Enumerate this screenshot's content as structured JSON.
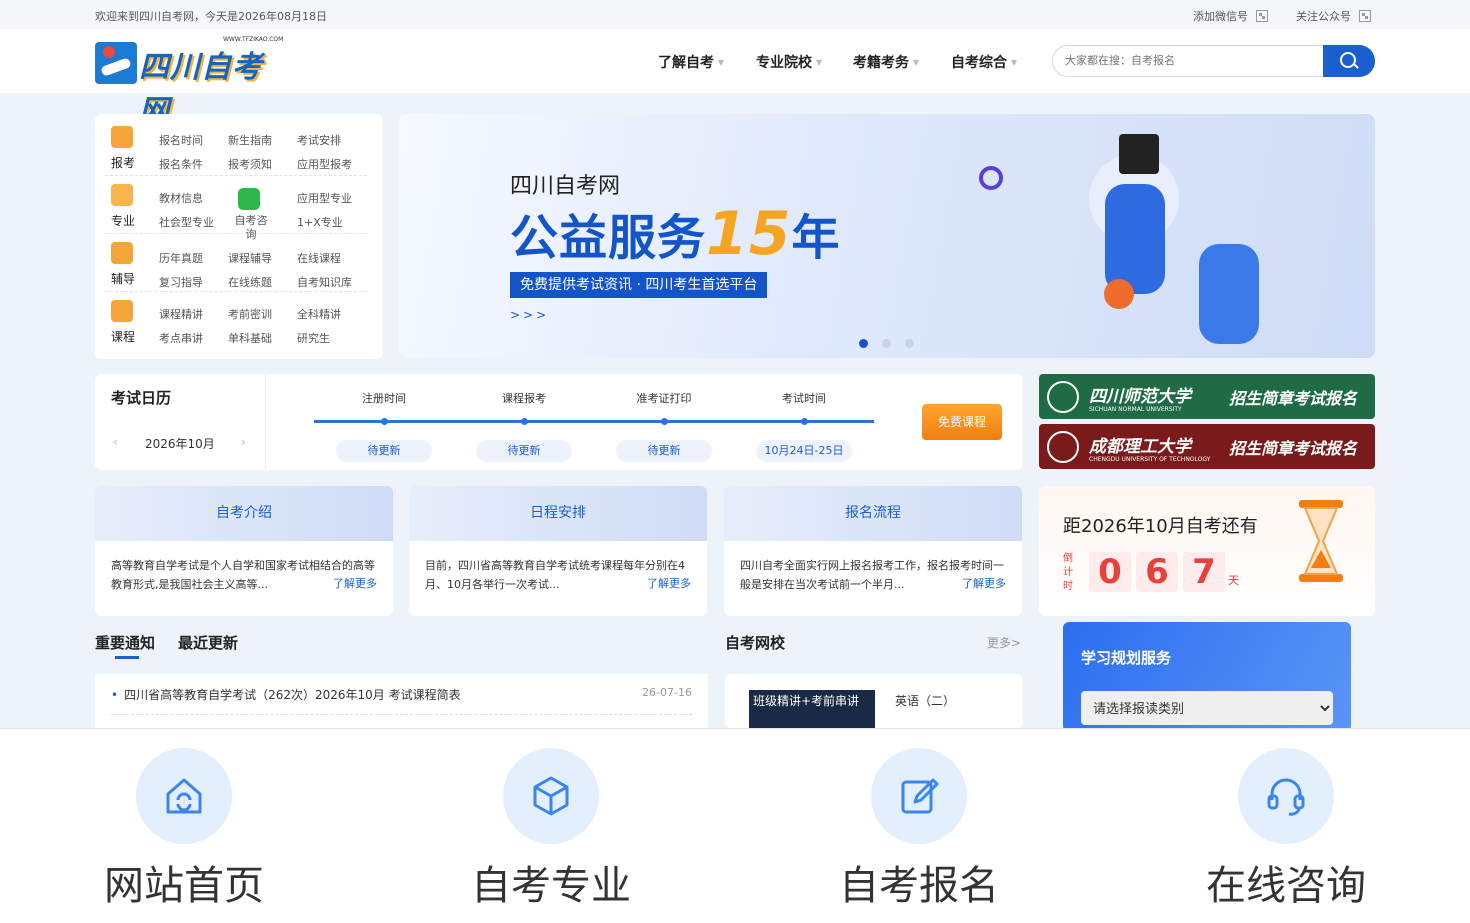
{
  "topbar": {
    "welcome": "欢迎来到四川自考网，今天是2026年08月18日",
    "wechat": "添加微信号",
    "official": "关注公众号"
  },
  "logo": {
    "text": "四川自考网",
    "url_text": "WWW.TFZIKAO.COM"
  },
  "nav": [
    "了解自考",
    "专业院校",
    "考籍考务",
    "自考综合"
  ],
  "search": {
    "placeholder": "大家都在搜：自考报名"
  },
  "menu": {
    "rows": [
      {
        "label": "报考",
        "items": [
          "报名时间",
          "新生指南",
          "考试安排",
          "报名条件",
          "报考须知",
          "应用型报考"
        ]
      },
      {
        "label": "专业",
        "items": [
          "教材信息",
          "自考咨询",
          "应用型专业",
          "社会型专业",
          "1+X专业"
        ]
      },
      {
        "label": "辅导",
        "items": [
          "历年真题",
          "课程辅导",
          "在线课程",
          "复习指导",
          "在线练题",
          "自考知识库"
        ]
      },
      {
        "label": "课程",
        "items": [
          "课程精讲",
          "考前密训",
          "全科精讲",
          "考点串讲",
          "单科基础",
          "研究生"
        ]
      }
    ]
  },
  "banner": {
    "line1": "四川自考网",
    "line2a": "公益服务",
    "line2b": "15",
    "line2c": "年",
    "line3": "免费提供考试资讯 · 四川考生首选平台",
    "arrows": ">>>"
  },
  "calendar": {
    "title": "考试日历",
    "month": "2026年10月",
    "steps": [
      "注册时间",
      "课程报考",
      "准考证打印",
      "考试时间"
    ],
    "values": [
      "待更新",
      "待更新",
      "待更新",
      "10月24日-25日"
    ],
    "free_btn": "免费课程"
  },
  "universities": [
    {
      "name": "四川师范大学",
      "en": "SICHUAN NORMAL UNIVERSITY",
      "tag": "招生简章考试报名",
      "color": "#1f6b45"
    },
    {
      "name": "成都理工大学",
      "en": "CHENGDU UNIVERSITY OF TECHNOLOGY",
      "tag": "招生简章考试报名",
      "color": "#7a1a1a"
    }
  ],
  "cards": [
    {
      "title": "自考介绍",
      "body": "高等教育自学考试是个人自学和国家考试相结合的高等教育形式,是我国社会主义高等...",
      "more": "了解更多"
    },
    {
      "title": "日程安排",
      "body": "目前，四川省高等教育自学考试统考课程每年分别在4月、10月各举行一次考试...",
      "more": "了解更多"
    },
    {
      "title": "报名流程",
      "body": "四川自考全面实行网上报名报考工作，报名报考时间一般是安排在当次考试前一个半月...",
      "more": "了解更多"
    }
  ],
  "countdown": {
    "title": "距2026年10月自考还有",
    "side": "倒计时",
    "digits": [
      "0",
      "6",
      "7"
    ],
    "unit": "天"
  },
  "news": {
    "tabs": [
      "重要通知",
      "最近更新"
    ],
    "items": [
      {
        "title": "四川省高等教育自学考试（262次）2026年10月 考试课程简表",
        "date": "26-07-16"
      }
    ]
  },
  "school": {
    "title": "自考网校",
    "more": "更多>",
    "course": {
      "thumb": "班级精讲+考前串讲",
      "name": "英语（二）"
    }
  },
  "plan": {
    "title": "学习规划服务",
    "select": "请选择报读类别"
  },
  "bottom_nav": [
    {
      "label": "网站首页",
      "icon": "home-icon"
    },
    {
      "label": "自考专业",
      "icon": "cube-icon"
    },
    {
      "label": "自考报名",
      "icon": "edit-icon"
    },
    {
      "label": "在线咨询",
      "icon": "headset-icon"
    }
  ]
}
